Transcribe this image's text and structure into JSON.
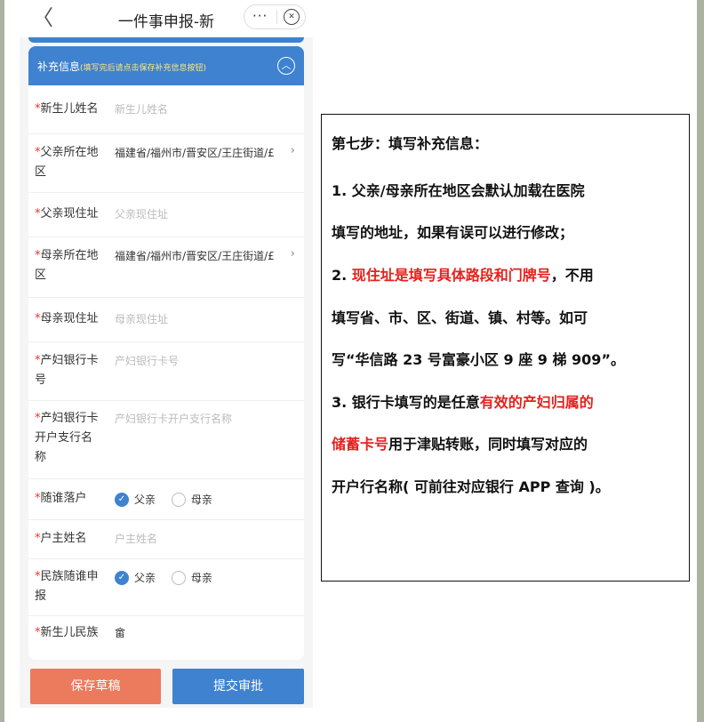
{
  "window": {
    "title": "一件事申报-新",
    "back_glyph": "〈",
    "more_glyph": "···",
    "close_glyph": "✕"
  },
  "section": {
    "title": "补充信息",
    "hint": "(填写完后请点击保存补充信息按钮)",
    "toggle_glyph": "︿"
  },
  "form": {
    "required_mark": "*",
    "newborn_name": {
      "label": "新生儿姓名",
      "placeholder": "新生儿姓名"
    },
    "father_region": {
      "label": "父亲所在地区",
      "value": "福建省/福州市/晋安区/王庄街道/£"
    },
    "father_address": {
      "label": "父亲现住址",
      "placeholder": "父亲现住址"
    },
    "mother_region": {
      "label": "母亲所在地区",
      "value": "福建省/福州市/晋安区/王庄街道/£"
    },
    "mother_address": {
      "label": "母亲现住址",
      "placeholder": "母亲现住址"
    },
    "bank_card": {
      "label": "产妇银行卡号",
      "placeholder": "产妇银行卡号"
    },
    "bank_branch": {
      "label": "产妇银行卡开户支行名称",
      "placeholder": "产妇银行卡开户支行名称"
    },
    "household_follow": {
      "label": "随谁落户",
      "options": [
        "父亲",
        "母亲"
      ],
      "selected": "父亲"
    },
    "householder_name": {
      "label": "户主姓名",
      "placeholder": "户主姓名"
    },
    "ethnicity_follow": {
      "label": "民族随谁申报",
      "options": [
        "父亲",
        "母亲"
      ],
      "selected": "父亲"
    },
    "newborn_ethnicity": {
      "label": "新生儿民族",
      "value": "畲"
    },
    "chevron_glyph": "›",
    "check_glyph": "✓"
  },
  "buttons": {
    "save_draft": "保存草稿",
    "submit": "提交审批"
  },
  "instructions": {
    "step_title": "第七步：填写补充信息：",
    "p1_line1": "1. 父亲/母亲所在地区会默认加载在医院",
    "p1_line2": "填写的地址，如果有误可以进行修改；",
    "p2_num": "2. ",
    "p2_red": "现住址是填写具体路段和门牌号",
    "p2_rest": "，不用",
    "p2_line2": "填写省、市、区、街道、镇、村等。如可",
    "p2_line3": "写“华信路 23 号富豪小区 9 座 9 梯 909”。",
    "p3_prefix": "3. 银行卡填写的是任意",
    "p3_red1": "有效的产妇归属的",
    "p3_red2": "储蓄卡号",
    "p3_rest": "用于津贴转账，同时填写对应的",
    "p3_line3": "开户行名称( 可前往对应银行 APP 查询 )。"
  },
  "colors": {
    "primary": "#3f82cf",
    "draft_button": "#ec7a5d",
    "required": "#e5352f",
    "highlight_red": "#e5211d"
  }
}
